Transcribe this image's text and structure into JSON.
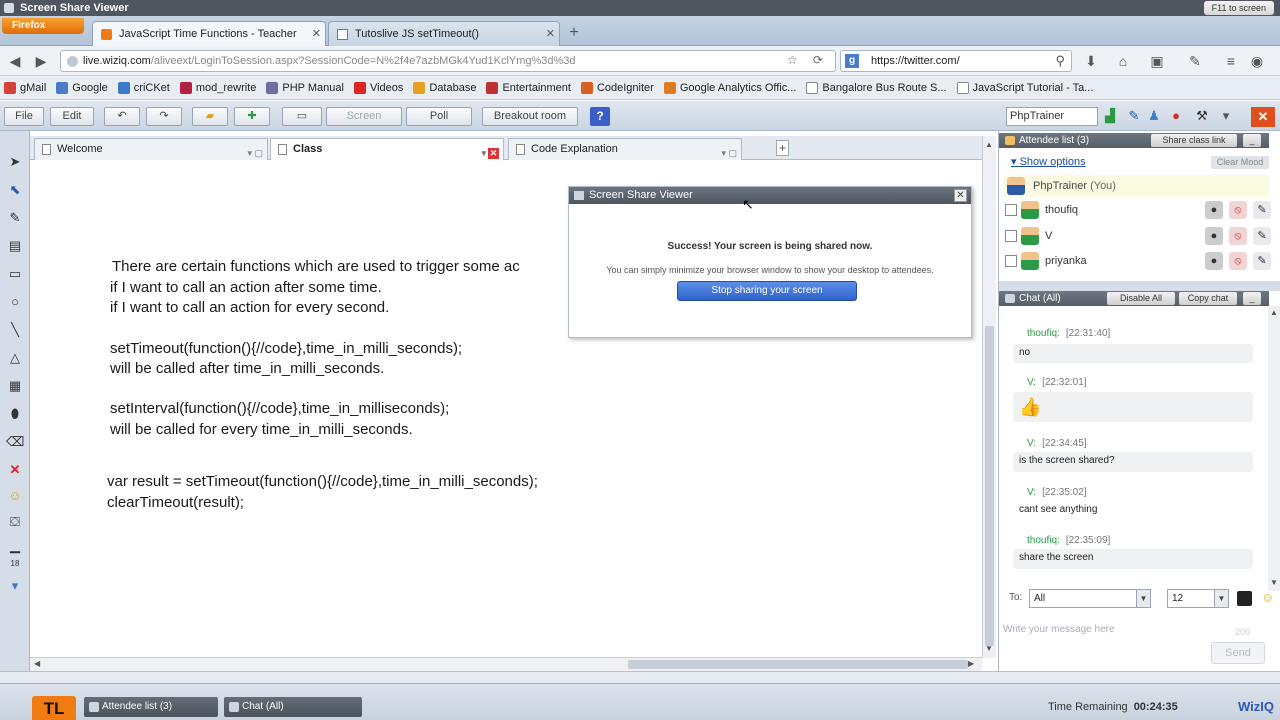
{
  "os_title": {
    "text": "Screen Share Viewer",
    "fullscreen_label": "F11 to screen"
  },
  "browser": {
    "menu_label": "Firefox",
    "tabs": [
      {
        "label": "JavaScript Time Functions - Teacher",
        "active": true
      },
      {
        "label": "Tutoslive JS setTimeout()",
        "active": false
      }
    ],
    "url_host": "live.wiziq.com",
    "url_path": "/aliveext/LoginToSession.aspx?SessionCode=N%2f4e7azbMGk4Yud1KclYmg%3d%3d",
    "search_value": "https://twitter.com/",
    "bookmarks": [
      {
        "label": "gMail",
        "color": "#d8413a"
      },
      {
        "label": "Google",
        "color": "#4a7cc9"
      },
      {
        "label": "criCKet",
        "color": "#3a7cc9"
      },
      {
        "label": "mod_rewrite",
        "color": "#b02040"
      },
      {
        "label": "PHP Manual",
        "color": "#6b6fa8"
      },
      {
        "label": "Videos",
        "color": "#d22"
      },
      {
        "label": "Database",
        "color": "#e8a020"
      },
      {
        "label": "Entertainment",
        "color": "#c03030"
      },
      {
        "label": "CodeIgniter",
        "color": "#d86020"
      },
      {
        "label": "Google Analytics Offic...",
        "color": "#e07a20"
      },
      {
        "label": "Bangalore Bus Route S...",
        "color": "#ffffff"
      },
      {
        "label": "JavaScript Tutorial - Ta...",
        "color": "#ffffff"
      }
    ]
  },
  "toolbar": {
    "file": "File",
    "edit": "Edit",
    "screen": "Screen",
    "poll": "Poll",
    "breakout": "Breakout room",
    "help": "?",
    "trainer_name": "PhpTrainer"
  },
  "whiteboard": {
    "tabs": [
      {
        "label": "Welcome"
      },
      {
        "label": "Class",
        "active": true
      },
      {
        "label": "Code Explanation"
      }
    ],
    "lines": [
      "There are certain functions which are used to trigger some ac",
      "if I want to call an action after some time.",
      "if I want to call an action for every second.",
      "setTimeout(function(){//code},time_in_milli_seconds);",
      "will be called after time_in_milli_seconds.",
      "setInterval(function(){//code},time_in_milliseconds);",
      "will be called for every time_in_milli_seconds.",
      "var result = setTimeout(function(){//code},time_in_milli_seconds);",
      "clearTimeout(result);"
    ]
  },
  "share_dialog": {
    "title": "Screen Share Viewer",
    "message": "Success! Your screen is being shared now.",
    "sub": "You can simply minimize your browser window to show your desktop to attendees.",
    "stop_label": "Stop sharing your screen"
  },
  "attendees": {
    "header": "Attendee list (3)",
    "share_link": "Share class link",
    "show_options": "Show options",
    "clear_mood": "Clear Mood",
    "me": "PhpTrainer",
    "me_suffix": "(You)",
    "list": [
      "thoufiq",
      "V",
      "priyanka"
    ]
  },
  "chat": {
    "header": "Chat (All)",
    "disable_all": "Disable All",
    "copy_chat": "Copy chat",
    "messages": [
      {
        "who": "thoufiq:",
        "time": "[22:31:40]",
        "text": "no"
      },
      {
        "who": "V:",
        "time": "[22:32:01]",
        "text": ""
      },
      {
        "who": "V:",
        "time": "[22:34:45]",
        "text": "is the screen shared?"
      },
      {
        "who": "V:",
        "time": "[22:35:02]",
        "text": "cant see anything"
      },
      {
        "who": "thoufiq:",
        "time": "[22:35:09]",
        "text": "share the screen"
      }
    ],
    "to_label": "To:",
    "to_value": "All",
    "size_value": "12",
    "placeholder": "Write your message here",
    "char_count": "200",
    "send": "Send"
  },
  "taskbar": {
    "logo": "TL",
    "attendee_btn": "Attendee list (3)",
    "chat_btn": "Chat (All)",
    "time_label": "Time Remaining",
    "time_value": "00:24:35",
    "brand": "WizIQ"
  }
}
